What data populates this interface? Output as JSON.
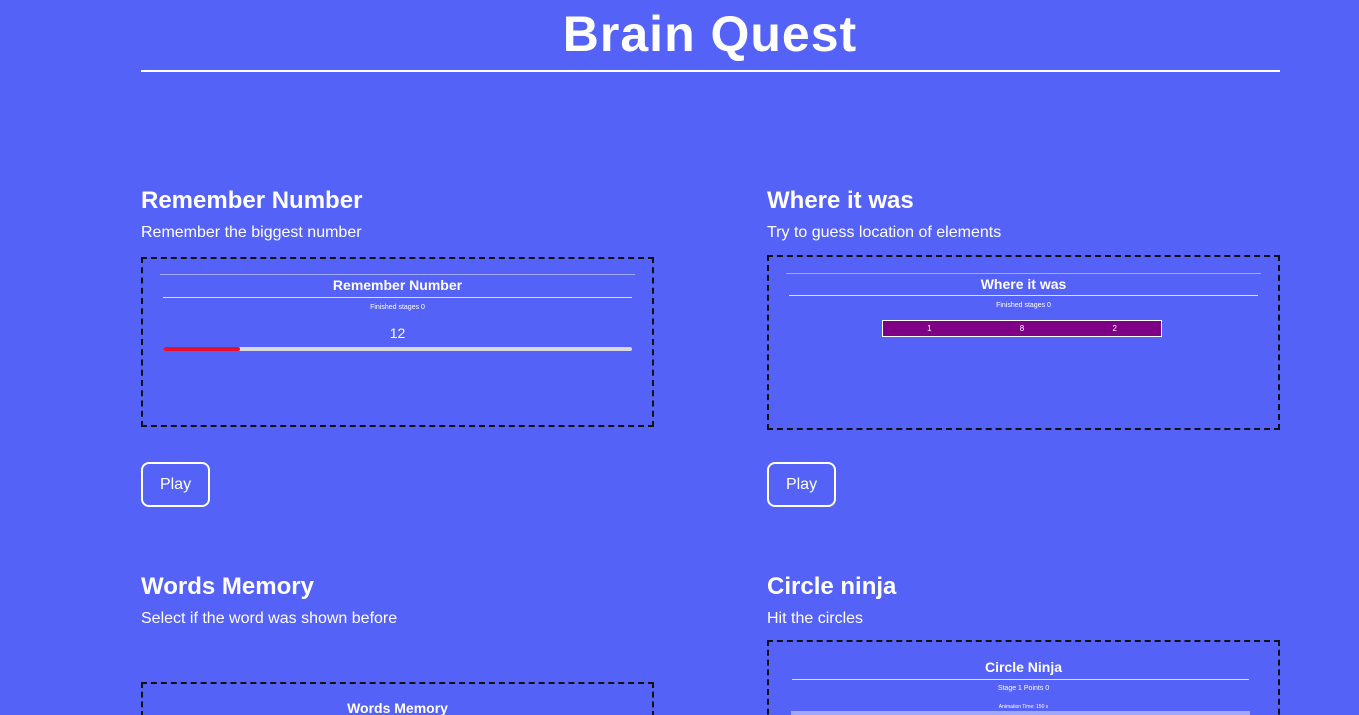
{
  "site": {
    "title": "Brain Quest"
  },
  "games": {
    "remember_number": {
      "title": "Remember Number",
      "description": "Remember the biggest number",
      "preview": {
        "title": "Remember Number",
        "finished_stages": "Finished stages 0",
        "number": "12",
        "progress_percent": 16.5,
        "progress_color": "#e8102e"
      },
      "play_label": "Play"
    },
    "where_it_was": {
      "title": "Where it was",
      "description": "Try to guess location of elements",
      "preview": {
        "title": "Where it was",
        "finished_stages": "Finished stages 0",
        "slots": [
          "1",
          "8",
          "2"
        ],
        "slot_color": "#7d0085"
      },
      "play_label": "Play"
    },
    "words_memory": {
      "title": "Words Memory",
      "description": "Select if the word was shown before",
      "preview": {
        "title": "Words Memory"
      }
    },
    "circle_ninja": {
      "title": "Circle ninja",
      "description": "Hit the circles",
      "preview": {
        "title": "Circle Ninja",
        "stage_points": "Stage 1 Points 0",
        "animation_time": "Animation Time: 150 s"
      }
    }
  },
  "colors": {
    "background": "#5562f8",
    "text": "#ffffff",
    "border": "#111111"
  }
}
